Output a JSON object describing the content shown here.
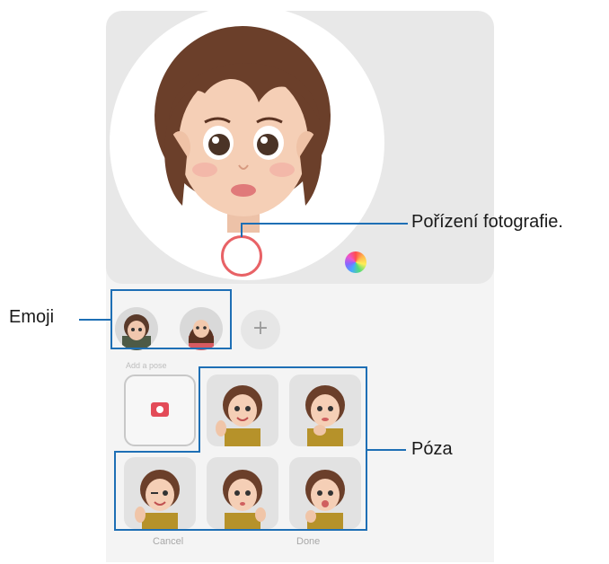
{
  "callouts": {
    "capture": "Pořízení fotografie.",
    "emoji": "Emoji",
    "pose": "Póza"
  },
  "screen": {
    "section_label": "Add a pose",
    "add_icon": "+",
    "cancel_label": "Cancel",
    "done_label": "Done"
  },
  "icons": {
    "shutter": "shutter-button",
    "palette": "color-palette-icon",
    "camera": "camera-icon",
    "add": "plus-icon"
  },
  "colors": {
    "callout": "#1e6fb5",
    "shutter_ring": "#e86266",
    "camera_icon": "#e34b58",
    "hair": "#6b3f2a",
    "skin": "#f5cfb6"
  }
}
